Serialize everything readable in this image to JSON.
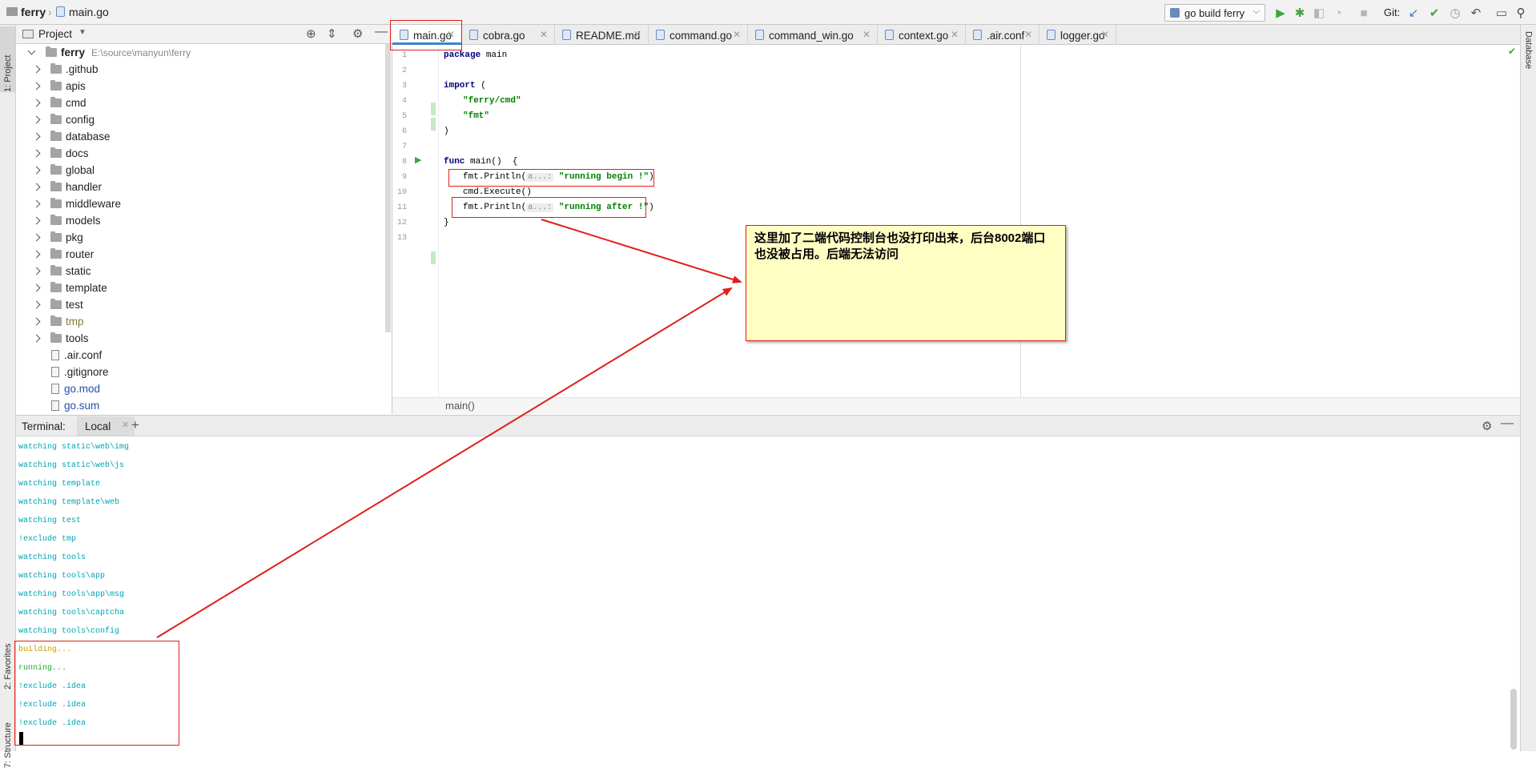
{
  "navbar": {
    "project": "ferry",
    "file": "main.go",
    "run_config": "go build ferry",
    "git_label": "Git:"
  },
  "side_tabs": {
    "project": "1: Project",
    "favorites": "2: Favorites",
    "structure": "7: Structure",
    "database": "Database"
  },
  "project_panel": {
    "title": "Project",
    "root": "ferry",
    "root_path": "E:\\source\\manyun\\ferry",
    "folders": [
      ".github",
      "apis",
      "cmd",
      "config",
      "database",
      "docs",
      "global",
      "handler",
      "middleware",
      "models",
      "pkg",
      "router",
      "static",
      "template",
      "test",
      "tmp",
      "tools"
    ],
    "files": [
      ".air.conf",
      ".gitignore",
      "go.mod",
      "go.sum"
    ]
  },
  "tabs": [
    "main.go",
    "cobra.go",
    "README.md",
    "command.go",
    "command_win.go",
    "context.go",
    ".air.conf",
    "logger.go"
  ],
  "code": {
    "line_numbers": [
      "1",
      "2",
      "3",
      "4",
      "5",
      "6",
      "7",
      "8",
      "9",
      "10",
      "11",
      "12",
      "13"
    ],
    "l1_kw": "package",
    "l1_rest": " main",
    "l3_kw": "import",
    "l3_rest": " (",
    "l4": "\"ferry/cmd\"",
    "l5": "\"fmt\"",
    "l6": ")",
    "l8_kw": "func",
    "l8_rest": " main()  {",
    "l9_pre": "fmt.Println(",
    "l9_hint": "a...:",
    "l9_str": "\"running begin !\"",
    "l9_post": ")",
    "l10": "cmd.Execute()",
    "l11_pre": "fmt.Println(",
    "l11_hint": "a...:",
    "l11_str": "\"running after !\"",
    "l11_post": ")",
    "l12": "}",
    "breadcrumb": "main()"
  },
  "terminal": {
    "label": "Terminal:",
    "tab": "Local",
    "lines": [
      "watching static\\web\\img",
      "watching static\\web\\js",
      "watching template",
      "watching template\\web",
      "watching test",
      "!exclude tmp",
      "watching tools",
      "watching tools\\app",
      "watching tools\\app\\msg",
      "watching tools\\captcha",
      "watching tools\\config",
      "building...",
      "running...",
      "!exclude .idea",
      "!exclude .idea",
      "!exclude .idea"
    ]
  },
  "annotation": {
    "text": "这里加了二端代码控制台也没打印出来，后台8002端口也没被占用。后端无法访问",
    "color": "#e0201a"
  }
}
